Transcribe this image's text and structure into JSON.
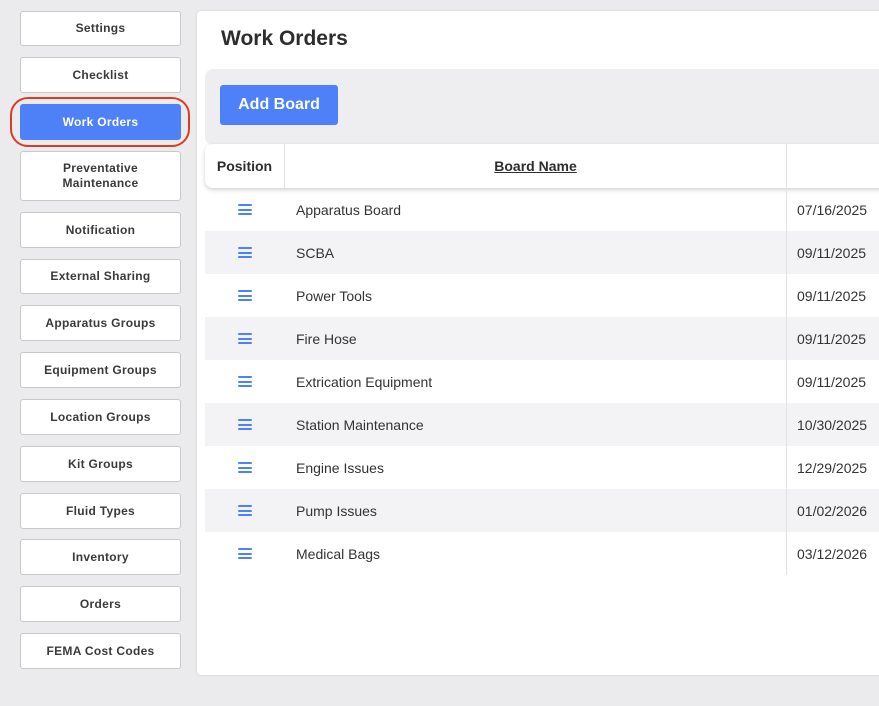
{
  "sidebar": {
    "items": [
      {
        "label": "Settings",
        "active": false
      },
      {
        "label": "Checklist",
        "active": false
      },
      {
        "label": "Work Orders",
        "active": true
      },
      {
        "label": "Preventative Maintenance",
        "active": false
      },
      {
        "label": "Notification",
        "active": false
      },
      {
        "label": "External Sharing",
        "active": false
      },
      {
        "label": "Apparatus Groups",
        "active": false
      },
      {
        "label": "Equipment Groups",
        "active": false
      },
      {
        "label": "Location Groups",
        "active": false
      },
      {
        "label": "Kit Groups",
        "active": false
      },
      {
        "label": "Fluid Types",
        "active": false
      },
      {
        "label": "Inventory",
        "active": false
      },
      {
        "label": "Orders",
        "active": false
      },
      {
        "label": "FEMA Cost Codes",
        "active": false
      }
    ]
  },
  "main": {
    "title": "Work Orders",
    "add_button_label": "Add Board",
    "table": {
      "columns": [
        "Position",
        "Board Name",
        ""
      ],
      "rows": [
        {
          "name": "Apparatus Board",
          "date": "07/16/2025"
        },
        {
          "name": "SCBA",
          "date": "09/11/2025"
        },
        {
          "name": "Power Tools",
          "date": "09/11/2025"
        },
        {
          "name": "Fire Hose",
          "date": "09/11/2025"
        },
        {
          "name": "Extrication Equipment",
          "date": "09/11/2025"
        },
        {
          "name": "Station Maintenance",
          "date": "10/30/2025"
        },
        {
          "name": "Engine Issues",
          "date": "12/29/2025"
        },
        {
          "name": "Pump Issues",
          "date": "01/02/2026"
        },
        {
          "name": "Medical Bags",
          "date": "03/12/2026"
        }
      ]
    }
  },
  "colors": {
    "accent": "#4e80f7",
    "highlight_ring": "#e03a24",
    "page_background": "#ebebee"
  }
}
